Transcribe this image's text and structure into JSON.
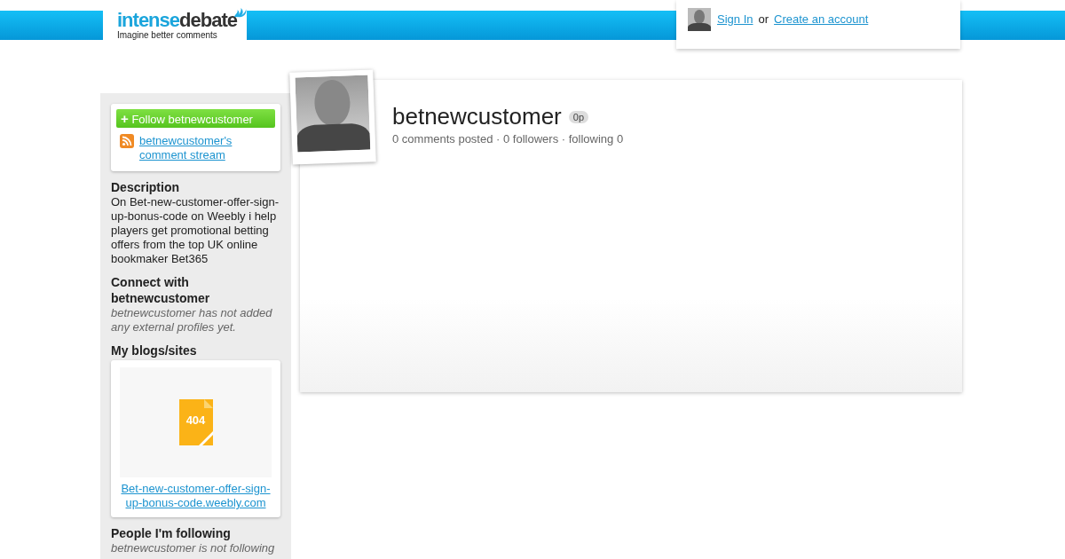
{
  "header": {
    "logo_left": "intense",
    "logo_right": "debate",
    "tagline": "Imagine better comments",
    "sign_in": "Sign In",
    "or": "or",
    "create_account": "Create an account"
  },
  "sidebar": {
    "follow_button": "Follow betnewcustomer",
    "follow_plus": "+",
    "stream_link": "betnewcustomer's comment stream",
    "sections": [
      {
        "kind": "text",
        "title": "Description",
        "body": "On Bet-new-customer-offer-sign-up-bonus-code on Weebly i help players get promotional betting offers from the top UK online bookmaker Bet365"
      },
      {
        "kind": "note",
        "title": "Connect with betnewcustomer",
        "body": "betnewcustomer has not added any external profiles yet."
      },
      {
        "kind": "site",
        "title": "My blogs/sites",
        "badge": "404",
        "link": "Bet-new-customer-offer-sign-up-bonus-code.weebly.com"
      },
      {
        "kind": "note",
        "title": "People I'm following",
        "body": "betnewcustomer is not following"
      }
    ]
  },
  "profile": {
    "username": "betnewcustomer",
    "points": "0p",
    "stats": "0 comments posted · 0 followers · following 0"
  }
}
